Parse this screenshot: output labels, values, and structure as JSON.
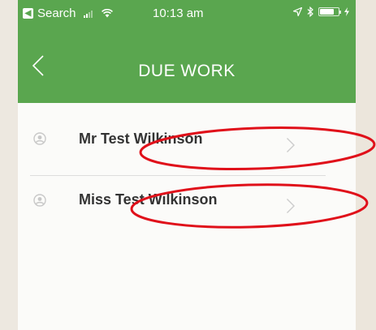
{
  "status_bar": {
    "back_app_label": "Search",
    "time": "10:13 am",
    "battery_level": 0.8
  },
  "nav": {
    "title": "DUE WORK"
  },
  "students": [
    {
      "name": "Mr  Test Wilkinson"
    },
    {
      "name": "Miss Test Wilkinson"
    }
  ],
  "colors": {
    "header": "#5aa64f",
    "annotation": "#e0101a",
    "text": "#333333"
  },
  "icons": {
    "back": "chevron-left-icon",
    "person": "person-icon",
    "row": "chevron-right-icon"
  }
}
